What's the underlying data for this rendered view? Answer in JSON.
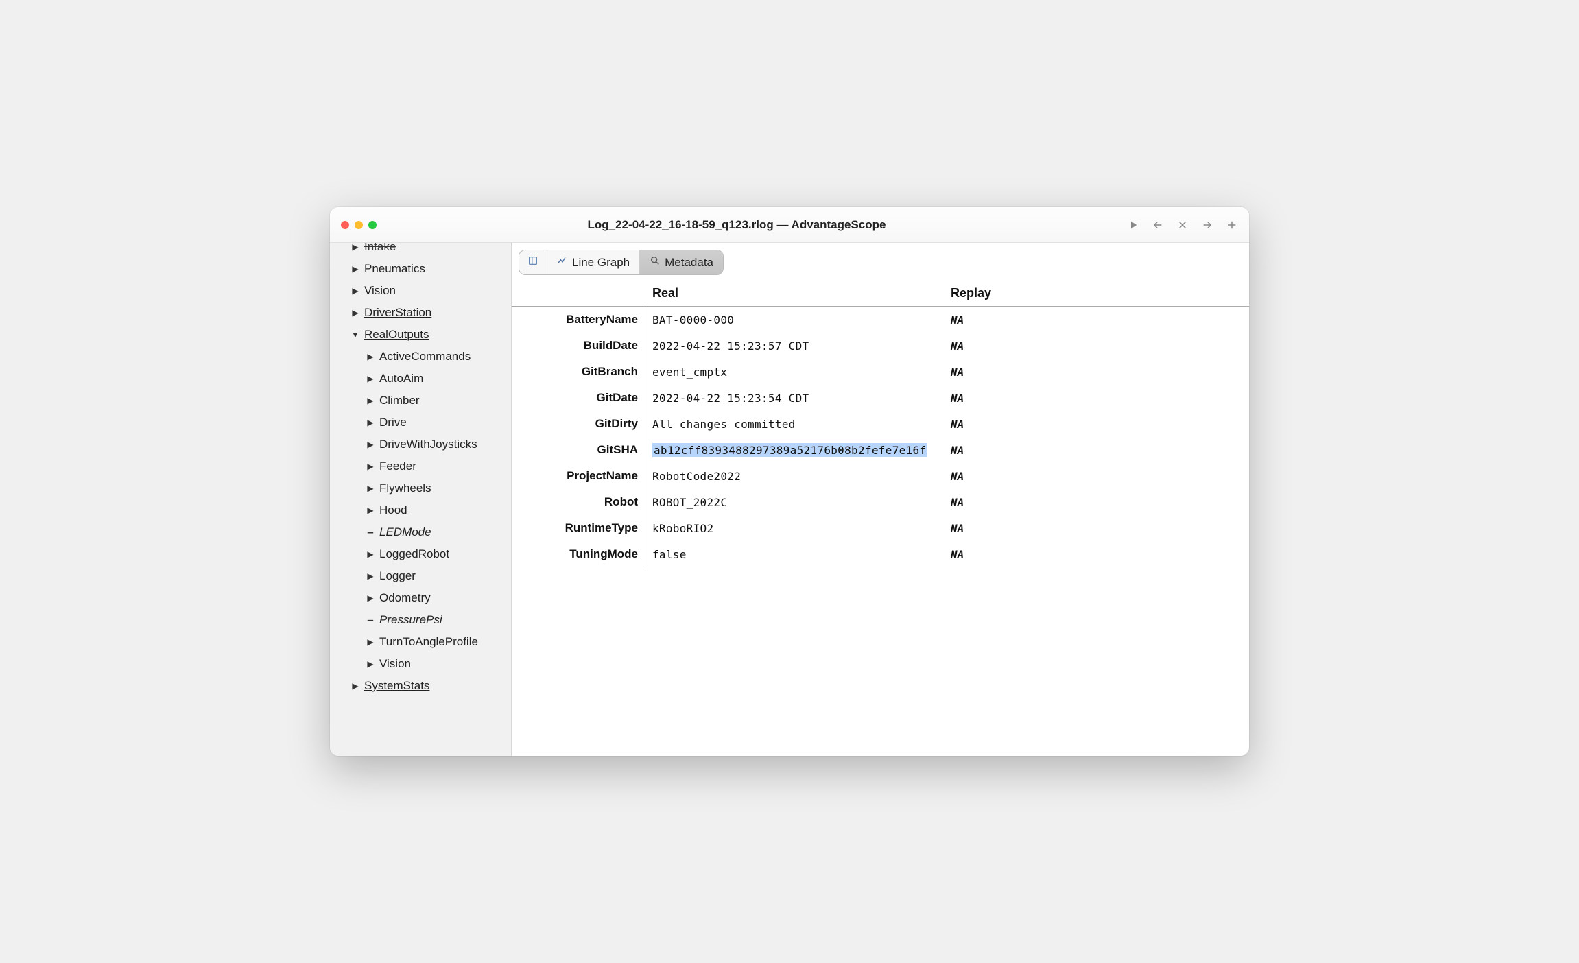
{
  "window": {
    "title": "Log_22-04-22_16-18-59_q123.rlog — AdvantageScope"
  },
  "toolbar_actions": {
    "play": "play-icon",
    "back": "arrow-left-icon",
    "close": "close-icon",
    "forward": "arrow-right-icon",
    "add": "plus-icon"
  },
  "sidebar": {
    "items": [
      {
        "label": "Intake",
        "depth": 1,
        "marker": "arrow",
        "cutoff": true
      },
      {
        "label": "Pneumatics",
        "depth": 1,
        "marker": "arrow"
      },
      {
        "label": "Vision",
        "depth": 1,
        "marker": "arrow"
      },
      {
        "label": "DriverStation",
        "depth": 1,
        "marker": "arrow",
        "underline": true
      },
      {
        "label": "RealOutputs",
        "depth": 1,
        "marker": "arrow-down",
        "underline": true
      },
      {
        "label": "ActiveCommands",
        "depth": 2,
        "marker": "arrow"
      },
      {
        "label": "AutoAim",
        "depth": 2,
        "marker": "arrow"
      },
      {
        "label": "Climber",
        "depth": 2,
        "marker": "arrow"
      },
      {
        "label": "Drive",
        "depth": 2,
        "marker": "arrow"
      },
      {
        "label": "DriveWithJoysticks",
        "depth": 2,
        "marker": "arrow"
      },
      {
        "label": "Feeder",
        "depth": 2,
        "marker": "arrow"
      },
      {
        "label": "Flywheels",
        "depth": 2,
        "marker": "arrow"
      },
      {
        "label": "Hood",
        "depth": 2,
        "marker": "arrow"
      },
      {
        "label": "LEDMode",
        "depth": 2,
        "marker": "dash",
        "italic": true
      },
      {
        "label": "LoggedRobot",
        "depth": 2,
        "marker": "arrow"
      },
      {
        "label": "Logger",
        "depth": 2,
        "marker": "arrow"
      },
      {
        "label": "Odometry",
        "depth": 2,
        "marker": "arrow"
      },
      {
        "label": "PressurePsi",
        "depth": 2,
        "marker": "dash",
        "italic": true
      },
      {
        "label": "TurnToAngleProfile",
        "depth": 2,
        "marker": "arrow"
      },
      {
        "label": "Vision",
        "depth": 2,
        "marker": "arrow"
      },
      {
        "label": "SystemStats",
        "depth": 1,
        "marker": "arrow",
        "underline": true
      }
    ]
  },
  "tabs": {
    "book_icon": "book-icon",
    "line_graph": "Line Graph",
    "metadata": "Metadata"
  },
  "columns": {
    "real": "Real",
    "replay": "Replay"
  },
  "metadata": [
    {
      "key": "BatteryName",
      "real": "BAT-0000-000",
      "replay": "NA"
    },
    {
      "key": "BuildDate",
      "real": "2022-04-22 15:23:57 CDT",
      "replay": "NA"
    },
    {
      "key": "GitBranch",
      "real": "event_cmptx",
      "replay": "NA"
    },
    {
      "key": "GitDate",
      "real": "2022-04-22 15:23:54 CDT",
      "replay": "NA"
    },
    {
      "key": "GitDirty",
      "real": "All changes committed",
      "replay": "NA"
    },
    {
      "key": "GitSHA",
      "real": "ab12cff8393488297389a52176b08b2fefe7e16f",
      "replay": "NA",
      "highlight": true
    },
    {
      "key": "ProjectName",
      "real": "RobotCode2022",
      "replay": "NA"
    },
    {
      "key": "Robot",
      "real": "ROBOT_2022C",
      "replay": "NA"
    },
    {
      "key": "RuntimeType",
      "real": "kRoboRIO2",
      "replay": "NA"
    },
    {
      "key": "TuningMode",
      "real": "false",
      "replay": "NA"
    }
  ]
}
